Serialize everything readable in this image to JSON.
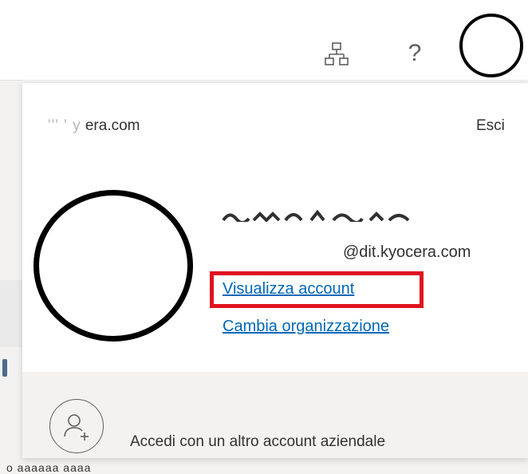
{
  "topbar": {
    "org_icon": "org-chart-icon",
    "help_icon": "help-icon",
    "help_glyph": "?",
    "avatar": "avatar-redacted"
  },
  "account_panel": {
    "tenant_domain_visible": "era.com",
    "tenant_domain_blurred_prefix": "''' ' y",
    "signout_label": "Esci",
    "user_email": "@dit.kyocera.com",
    "view_account_link": "Visualizza account",
    "switch_org_link": "Cambia organizzazione",
    "add_account_label": "Accedi con un altro account aziendale"
  },
  "bottom_cut_text": "o aaaaaa aaaa",
  "colors": {
    "link": "#0067b8",
    "highlight": "#e0131f",
    "panel_bg": "#ffffff",
    "footer_bg": "#f3f2f1"
  }
}
